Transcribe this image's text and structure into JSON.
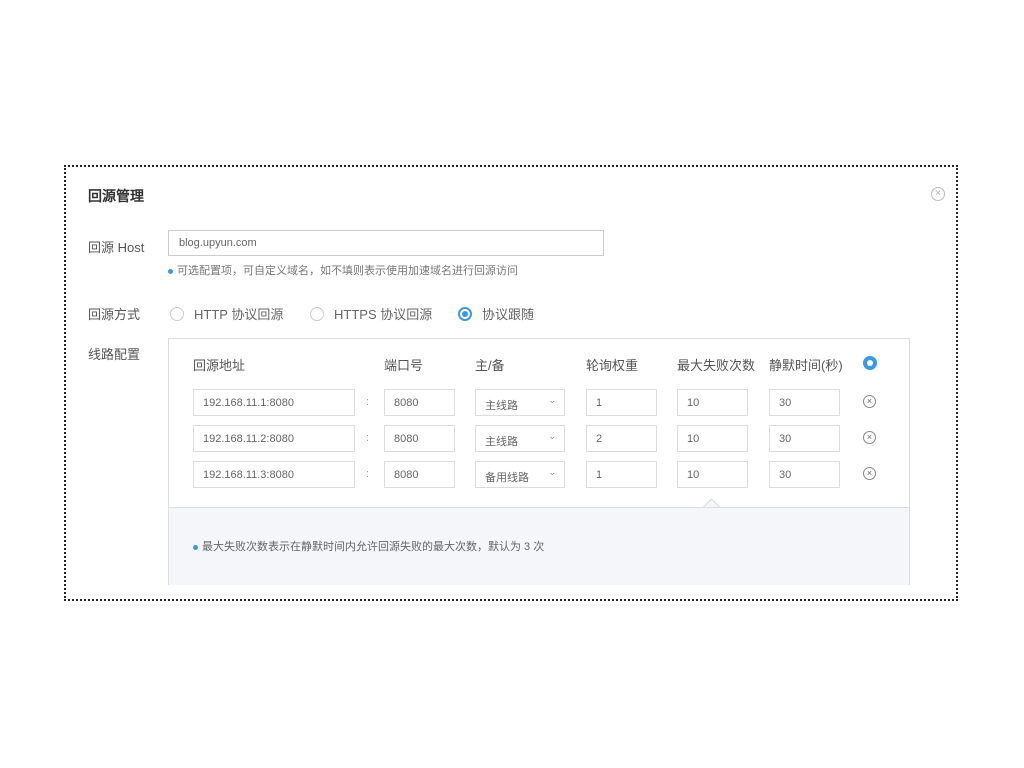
{
  "title": "回源管理",
  "close_icon": "close-circle-icon",
  "host": {
    "label": "回源 Host",
    "value": "blog.upyun.com",
    "hint": "可选配置项，可自定义域名，如不填则表示使用加速域名进行回源访问"
  },
  "mode": {
    "label": "回源方式",
    "options": [
      "HTTP 协议回源",
      "HTTPS 协议回源",
      "协议跟随"
    ],
    "selected": "协议跟随"
  },
  "lines": {
    "label": "线路配置",
    "headers": [
      "回源地址",
      "端口号",
      "主/备",
      "轮询权重",
      "最大失败次数",
      "静默时间(秒)"
    ],
    "add_icon": "add-circle-icon",
    "delete_icon": "remove-circle-icon",
    "rows": [
      {
        "address": "192.168.11.1:8080",
        "port": "8080",
        "role": "主线路",
        "weight": "1",
        "max_fail": "10",
        "silence": "30"
      },
      {
        "address": "192.168.11.2:8080",
        "port": "8080",
        "role": "主线路",
        "weight": "2",
        "max_fail": "10",
        "silence": "30"
      },
      {
        "address": "192.168.11.3:8080",
        "port": "8080",
        "role": "备用线路",
        "weight": "1",
        "max_fail": "10",
        "silence": "30"
      }
    ],
    "info": "最大失败次数表示在静默时间内允许回源失败的最大次数，默认为 3 次"
  },
  "colors": {
    "accent": "#3b9ae1",
    "border": "#dddddd",
    "info_bg": "#f4f6f9"
  }
}
